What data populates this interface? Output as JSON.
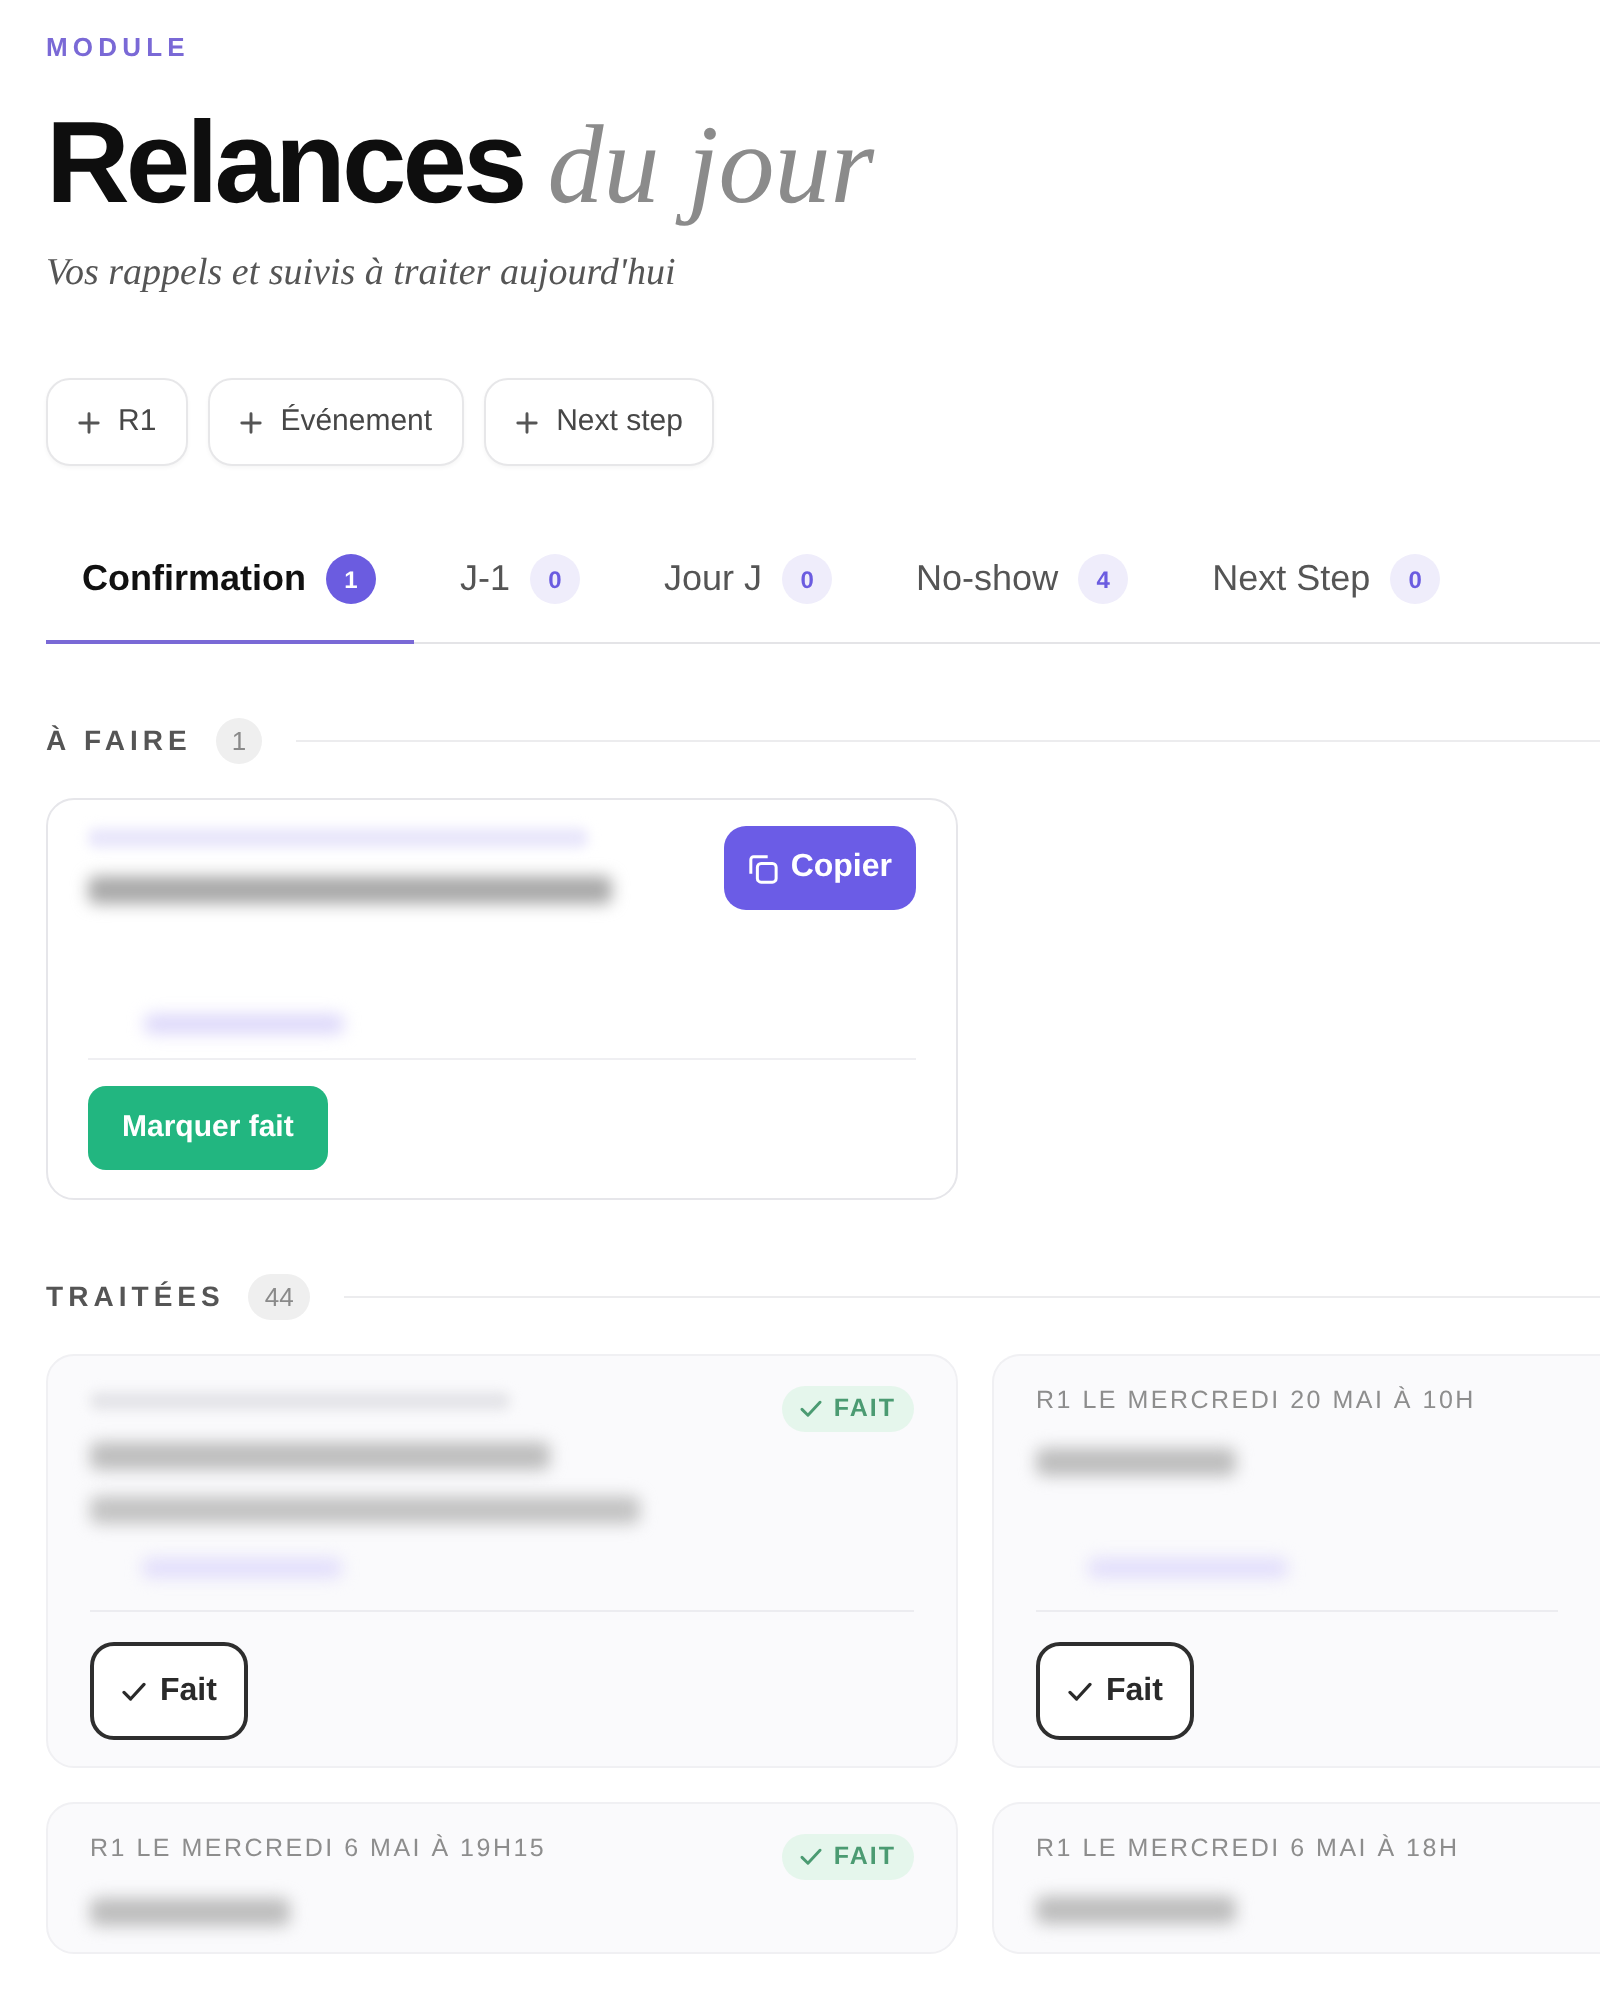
{
  "header": {
    "eyebrow": "MODULE",
    "title": "Relances",
    "title_accent": "du jour",
    "subtitle": "Vos rappels et suivis à traiter aujourd'hui"
  },
  "actions": [
    {
      "label": "R1"
    },
    {
      "label": "Événement"
    },
    {
      "label": "Next step"
    }
  ],
  "tabs": [
    {
      "label": "Confirmation",
      "count": "1",
      "selected": true
    },
    {
      "label": "J-1",
      "count": "0",
      "selected": false
    },
    {
      "label": "Jour J",
      "count": "0",
      "selected": false
    },
    {
      "label": "No-show",
      "count": "4",
      "selected": false
    },
    {
      "label": "Next Step",
      "count": "0",
      "selected": false
    }
  ],
  "sections": [
    {
      "title": "À FAIRE",
      "count": "1",
      "cards": [
        {
          "kind": "pending",
          "copy_button": "Copier",
          "action_button": "Marquer fait"
        }
      ]
    },
    {
      "title": "TRAITÉES",
      "count": "44",
      "cards": [
        {
          "kind": "done",
          "badge": "FAIT",
          "action_button": "Fait"
        },
        {
          "kind": "done",
          "header": "R1 LE MERCREDI 20 MAI À 10H",
          "action_button": "Fait"
        },
        {
          "kind": "done",
          "header": "R1 LE MERCREDI 6 MAI À 19H15",
          "badge": "FAIT"
        },
        {
          "kind": "done",
          "header": "R1 LE MERCREDI 6 MAI À 18H"
        }
      ]
    }
  ]
}
